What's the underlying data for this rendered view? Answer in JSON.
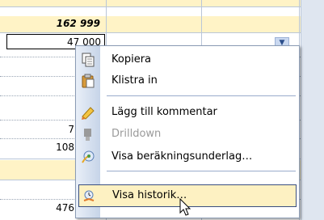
{
  "grid": {
    "total_value": "162 999",
    "selected_value": "47 000",
    "value_row_6": "7",
    "value_row_7": "108",
    "value_bottom": "476",
    "dropdown_glyph": "▼"
  },
  "context_menu": {
    "items": [
      {
        "label": "Kopiera",
        "icon": "copy-icon",
        "enabled": true
      },
      {
        "label": "Klistra in",
        "icon": "paste-icon",
        "enabled": true
      },
      {
        "label": "Lägg till kommentar",
        "icon": "comment-icon",
        "enabled": true
      },
      {
        "label": "Drilldown",
        "icon": "drilldown-icon",
        "enabled": false
      },
      {
        "label": "Visa beräkningsunderlag…",
        "icon": "calculation-basis-icon",
        "enabled": true
      },
      {
        "label": "Visa historik…",
        "icon": "history-icon",
        "enabled": true,
        "highlighted": true
      }
    ]
  },
  "colors": {
    "total_band": "#fff3c6",
    "menu_border": "#8a9bb4",
    "highlight": "#fdf1c2"
  }
}
